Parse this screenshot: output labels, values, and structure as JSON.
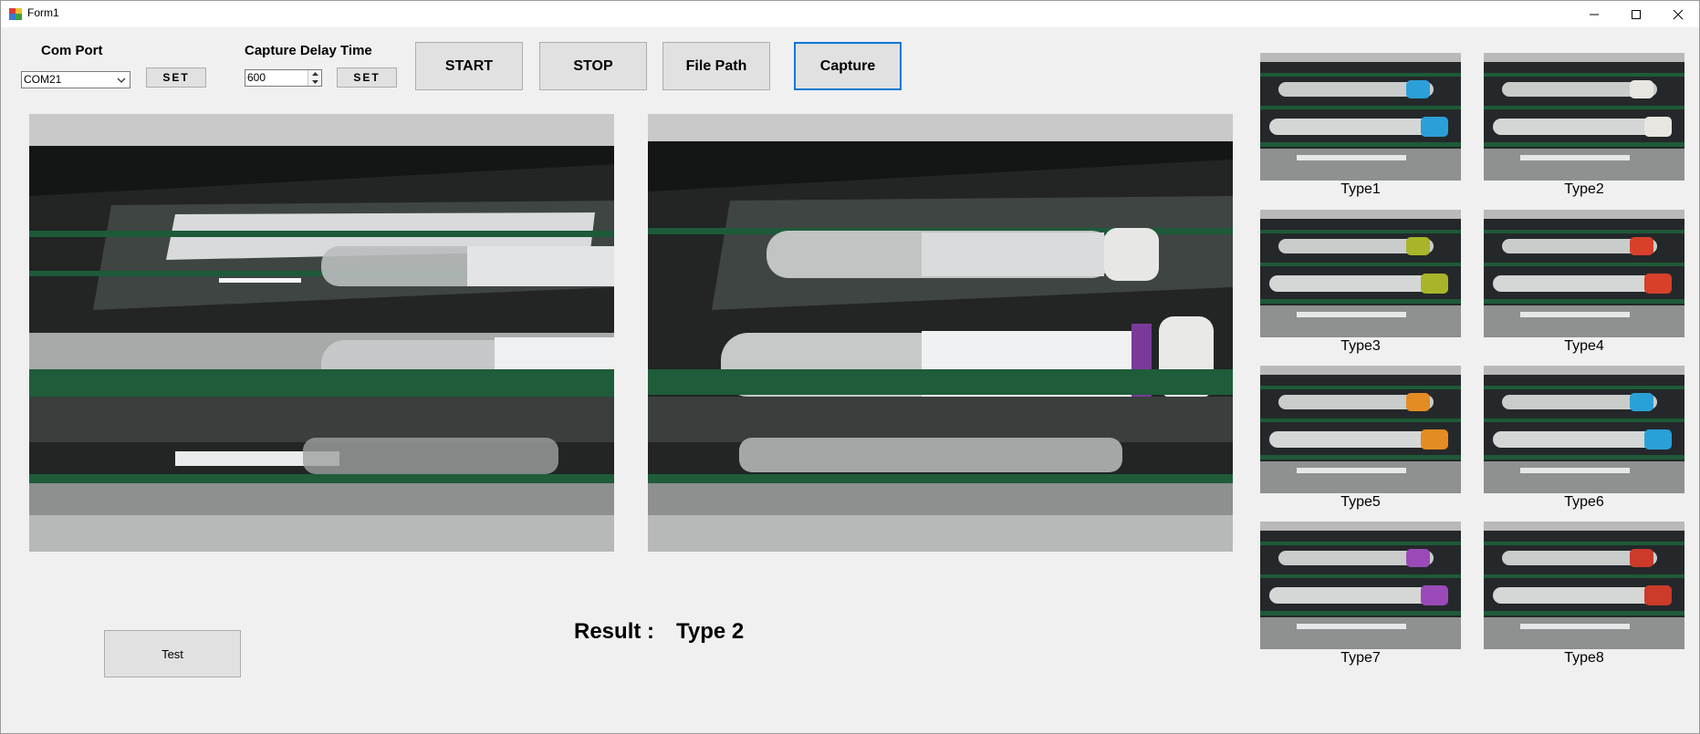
{
  "window": {
    "title": "Form1"
  },
  "controls": {
    "com_port_label": "Com Port",
    "com_port_value": "COM21",
    "com_set_label": "SET",
    "delay_label": "Capture Delay Time",
    "delay_value": "600",
    "delay_set_label": "SET",
    "start_label": "START",
    "stop_label": "STOP",
    "file_path_label": "File Path",
    "capture_label": "Capture",
    "test_label": "Test"
  },
  "result": {
    "label": "Result :",
    "value": "Type 2"
  },
  "thumbnails": [
    {
      "label": "Type1",
      "cap_color": "#2b9fd8"
    },
    {
      "label": "Type2",
      "cap_color": "#e8e6e0"
    },
    {
      "label": "Type3",
      "cap_color": "#a8b52a"
    },
    {
      "label": "Type4",
      "cap_color": "#d8402a"
    },
    {
      "label": "Type5",
      "cap_color": "#e48c24"
    },
    {
      "label": "Type6",
      "cap_color": "#2aa0d8"
    },
    {
      "label": "Type7",
      "cap_color": "#9a4ab8"
    },
    {
      "label": "Type8",
      "cap_color": "#cc3a2a"
    }
  ]
}
